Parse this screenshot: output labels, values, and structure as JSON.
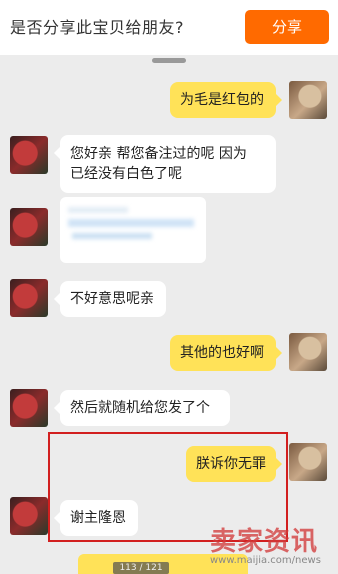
{
  "share_bar": {
    "prompt": "是否分享此宝贝给朋友?",
    "button_label": "分享"
  },
  "messages": [
    {
      "side": "out",
      "text": "为毛是红包的"
    },
    {
      "side": "in",
      "line1": "您好亲  帮您备注过的呢  因为",
      "line2": "已经没有白色了呢"
    },
    {
      "side": "in",
      "type": "card"
    },
    {
      "side": "in",
      "text": "不好意思呢亲"
    },
    {
      "side": "out",
      "text": "其他的也好啊"
    },
    {
      "side": "in",
      "text": "然后就随机给您发了个"
    },
    {
      "side": "out",
      "text": "朕诉你无罪"
    },
    {
      "side": "in",
      "text": "谢主隆恩"
    }
  ],
  "page_indicator": "113 / 121",
  "watermark": {
    "text": "卖家资讯",
    "url": "www.maijia.com/news"
  },
  "colors": {
    "accent": "#ff6a00",
    "outgoing_bubble": "#ffe258",
    "highlight": "#d21f1f"
  }
}
